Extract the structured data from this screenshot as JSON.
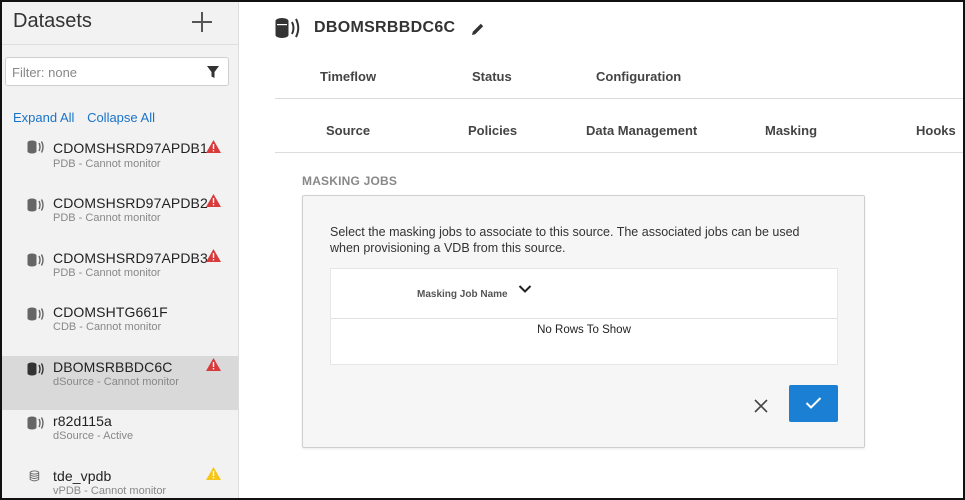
{
  "sidebar": {
    "title": "Datasets",
    "filter_placeholder": "Filter: none",
    "expand_all": "Expand All",
    "collapse_all": "Collapse All",
    "items": [
      {
        "name": "CDOMSHSRD97APDB1",
        "sub": "PDB - Cannot monitor",
        "icon": "database-signal-icon",
        "warning": "error"
      },
      {
        "name": "CDOMSHSRD97APDB2",
        "sub": "PDB - Cannot monitor",
        "icon": "database-signal-icon",
        "warning": "error"
      },
      {
        "name": "CDOMSHSRD97APDB3",
        "sub": "PDB - Cannot monitor",
        "icon": "database-signal-icon",
        "warning": "error"
      },
      {
        "name": "CDOMSHTG661F",
        "sub": "CDB - Cannot monitor",
        "icon": "database-signal-icon",
        "warning": "none"
      },
      {
        "name": "DBOMSRBBDC6C",
        "sub": "dSource - Cannot monitor",
        "icon": "database-signal-icon",
        "warning": "error",
        "selected": true
      },
      {
        "name": "r82d115a",
        "sub": "dSource - Active",
        "icon": "database-signal-icon",
        "warning": "none"
      },
      {
        "name": "tde_vpdb",
        "sub": "vPDB - Cannot monitor",
        "icon": "database-icon",
        "warning": "caution"
      }
    ]
  },
  "main": {
    "title": "DBOMSRBBDC6C",
    "tabs_primary": [
      "Timeflow",
      "Status",
      "Configuration"
    ],
    "tabs_secondary": [
      "Source",
      "Policies",
      "Data Management",
      "Masking",
      "Hooks"
    ],
    "section_label": "MASKING JOBS",
    "description": "Select the masking jobs to associate to this source. The associated jobs can be used when provisioning a VDB from this source.",
    "grid_column": "Masking Job Name",
    "grid_empty": "No Rows To Show"
  },
  "colors": {
    "accent": "#1b7fd3",
    "error": "#d93a3a",
    "caution": "#f5c518",
    "selected_row": "#d9d9d9"
  }
}
